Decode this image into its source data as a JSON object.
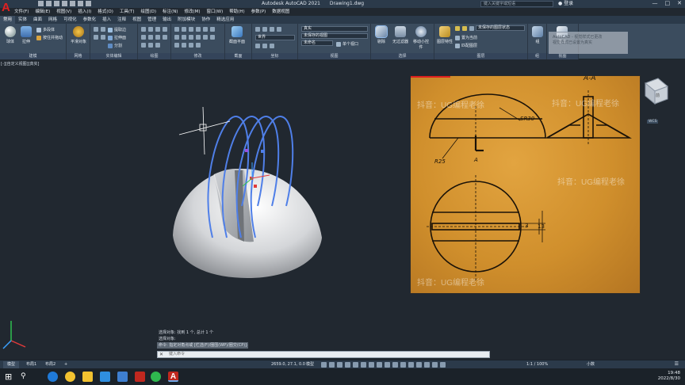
{
  "window": {
    "app_title": "Autodesk AutoCAD 2021",
    "file_title": "Drawing1.dwg",
    "search_placeholder": "键入关键字或短语",
    "login_label": "登录"
  },
  "menu": [
    "文件(F)",
    "编辑(E)",
    "视图(V)",
    "插入(I)",
    "格式(O)",
    "工具(T)",
    "绘图(D)",
    "标注(N)",
    "修改(M)",
    "窗口(W)",
    "帮助(H)",
    "参数(P)",
    "数据视图"
  ],
  "ribbon_tabs": [
    "常用",
    "实体",
    "曲面",
    "网格",
    "可视化",
    "参数化",
    "插入",
    "注释",
    "视图",
    "管理",
    "输出",
    "附加模块",
    "协作",
    "精选应用"
  ],
  "ribbon": {
    "modeling": {
      "box": "球体",
      "extrude": "拉伸",
      "polysolid": "多段体",
      "presspull": "按住并拖动",
      "title": "建模"
    },
    "mesh": {
      "smooth_label": "平滑对象",
      "title": "网格"
    },
    "solid_editing": {
      "extract_edges": "提取边",
      "extrude_face": "拉伸面",
      "separate": "分割",
      "title": "实体编辑"
    },
    "draw": {
      "title": "绘图"
    },
    "modify": {
      "title": "修改"
    },
    "section": {
      "section_plane": "截面平面",
      "title": "截面"
    },
    "coordinates": {
      "ucs_world": "世界",
      "title": "坐标"
    },
    "view": {
      "visual_style": "真实",
      "saved_view": "未保存的视图",
      "unnamed": "未命名",
      "single_viewport": "单个视口",
      "title": "视图"
    },
    "selection": {
      "culling": "剔除",
      "no_filter": "无过滤器",
      "gizmo": "移动小控件",
      "title": "选择"
    },
    "layers": {
      "layer_props": "图层特性",
      "layer_state": "未保存的图层状态",
      "match": "匹配图层",
      "off": "置为当前",
      "title": "图层"
    },
    "groups": {
      "group": "组",
      "title": "组"
    },
    "base": {
      "label": "基点",
      "title": "视图"
    }
  },
  "notification": {
    "line1": "AutoCAD - 视觉样式已更改",
    "line2": "视觉样式已设置为真实"
  },
  "viewport_label": "[-][自定义视图][真实]",
  "reference_image": {
    "section_label": "A-A",
    "label_sr30": "SR30",
    "label_r25": "R25",
    "label_a": "A",
    "dim_3": "3",
    "dim_13": "13",
    "watermarks": [
      "抖音：UG编程老徐",
      "抖音：UG编程老徐",
      "抖音：UG编程老徐",
      "抖音：UG编程老徐"
    ]
  },
  "viewcube": {
    "face": "前",
    "wcs": "WCS"
  },
  "command": {
    "history": [
      "选择对象: 找到 1 个, 总计 1 个",
      "选择对象:",
      "命令: 指定对角点或 [栏选(F)/圈围(WP)/圈交(CP)]:"
    ],
    "input_placeholder": "键入命令"
  },
  "status": {
    "layout_tabs": [
      "模型",
      "布局1",
      "布局2"
    ],
    "coords": "2659.0, 27.1, 0.0",
    "model_label": "模型",
    "scale": "1:1 / 100%",
    "units": "小数"
  },
  "taskbar": {
    "time": "19:48",
    "date": "2022/8/30"
  },
  "colors": {
    "accent_red": "#e02020",
    "ribbon_bg": "#3b4c5e",
    "viewport_bg": "#212830",
    "wire_blue": "#4f7fe8"
  }
}
